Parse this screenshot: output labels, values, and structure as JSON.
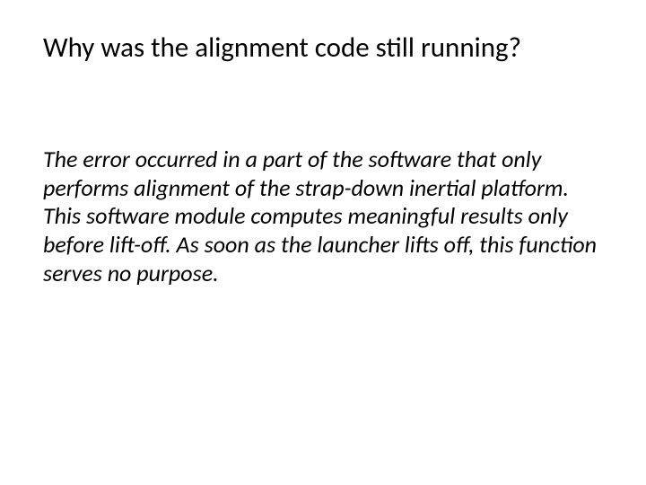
{
  "slide": {
    "title": "Why was the alignment code still running?",
    "body": "The error occurred in a part of the software that only performs alignment of the strap-down inertial platform. This software module computes meaningful results only before lift-off. As soon as the launcher lifts off, this function serves no purpose."
  }
}
